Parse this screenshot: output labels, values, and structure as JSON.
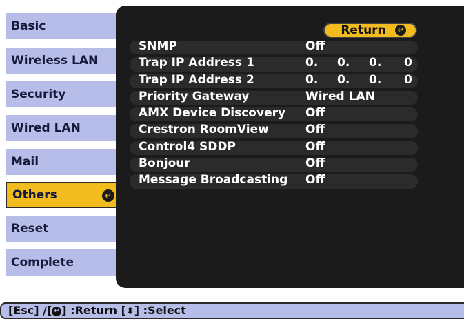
{
  "tabs": [
    {
      "label": "Basic"
    },
    {
      "label": "Wireless LAN"
    },
    {
      "label": "Security"
    },
    {
      "label": "Wired LAN"
    },
    {
      "label": "Mail"
    },
    {
      "label": "Others"
    },
    {
      "label": "Reset"
    },
    {
      "label": "Complete"
    }
  ],
  "return_label": "Return",
  "settings": [
    {
      "name": "SNMP",
      "value": "Off"
    },
    {
      "name": "Trap IP Address 1",
      "ip": [
        "0.",
        "0.",
        "0.",
        "0"
      ]
    },
    {
      "name": "Trap IP Address 2",
      "ip": [
        "0.",
        "0.",
        "0.",
        "0"
      ]
    },
    {
      "name": "Priority Gateway",
      "value": "Wired LAN"
    },
    {
      "name": "AMX Device Discovery",
      "value": "Off"
    },
    {
      "name": "Crestron RoomView",
      "value": "Off"
    },
    {
      "name": "Control4 SDDP",
      "value": "Off"
    },
    {
      "name": "Bonjour",
      "value": "Off"
    },
    {
      "name": "Message Broadcasting",
      "value": "Off"
    }
  ],
  "help": {
    "part1": "[Esc] /[",
    "part2": "] :Return  [",
    "part3": "] :Select"
  },
  "colors": {
    "tab": "#b6bde8",
    "active": "#f2bb1e",
    "panel": "#1b1b1b"
  }
}
